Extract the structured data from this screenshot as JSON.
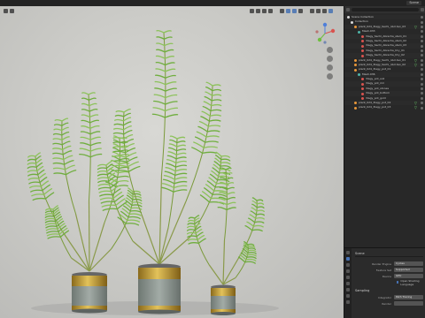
{
  "header": {
    "scene_label": "Scene"
  },
  "outliner": {
    "rows": [
      {
        "label": "Scene Collection",
        "indent": 0,
        "icon": "white",
        "filter": false
      },
      {
        "label": "Collection",
        "indent": 1,
        "icon": "white",
        "filter": false
      },
      {
        "label": "plant_024_3lagy_Sachi_nbcl.tex_03",
        "indent": 2,
        "icon": "orange",
        "filter": true
      },
      {
        "label": "Mesh.033",
        "indent": 3,
        "icon": "teal",
        "filter": false
      },
      {
        "label": "3lagy_Sachi_Abrecha_stem_01",
        "indent": 4,
        "icon": "red",
        "filter": false
      },
      {
        "label": "3lagy_Sachi_Abrecha_stem_02",
        "indent": 4,
        "icon": "red",
        "filter": false
      },
      {
        "label": "3lagy_Sachi_Abrecha_stem_03",
        "indent": 4,
        "icon": "red",
        "filter": false
      },
      {
        "label": "3lagy_Sachi_Abrecha_Dry_01",
        "indent": 4,
        "icon": "red",
        "filter": false
      },
      {
        "label": "3lagy_Sachi_Abrecha_Dry_02",
        "indent": 4,
        "icon": "red",
        "filter": false
      },
      {
        "label": "plant_024_3lagy_Sachi_nbcl.tex_01",
        "indent": 2,
        "icon": "orange",
        "filter": true
      },
      {
        "label": "plant_024_3lagy_Sachi_nbcl.tex_02",
        "indent": 2,
        "icon": "orange",
        "filter": true
      },
      {
        "label": "plant_024_3lagy_pot_01",
        "indent": 2,
        "icon": "orange",
        "filter": false
      },
      {
        "label": "Mesh.036",
        "indent": 3,
        "icon": "teal",
        "filter": false
      },
      {
        "label": "3lagy_pot_soil",
        "indent": 4,
        "icon": "red",
        "filter": false
      },
      {
        "label": "3lagy_pot_rim",
        "indent": 4,
        "icon": "red",
        "filter": false
      },
      {
        "label": "3lagy_pot_stones",
        "indent": 4,
        "icon": "red",
        "filter": false
      },
      {
        "label": "3lagy_pot_bottom",
        "indent": 4,
        "icon": "red",
        "filter": false
      },
      {
        "label": "3lagy_pot_gold",
        "indent": 4,
        "icon": "red",
        "filter": false
      },
      {
        "label": "plant_024_3lagy_pot_02",
        "indent": 2,
        "icon": "orange",
        "filter": true
      },
      {
        "label": "plant_024_3lagy_pot_03",
        "indent": 2,
        "icon": "orange",
        "filter": true
      }
    ]
  },
  "properties": {
    "title": "Scene",
    "rows": [
      {
        "key": "Render Engine",
        "value": "Cycles"
      },
      {
        "key": "Feature Set",
        "value": "Supported"
      },
      {
        "key": "Device",
        "value": "GPU"
      }
    ],
    "checkbox_label": "Open Shading Language",
    "section_title": "Sampling",
    "rows2": [
      {
        "key": "Integrator",
        "value": "Path Tracing"
      },
      {
        "key": "Render",
        "value": ""
      },
      {
        "key": "Viewport",
        "value": ""
      }
    ]
  },
  "colors": {
    "accent": "#4772b3",
    "pot_body": "#8c9691",
    "pot_gold": "#c9a23a",
    "leaf": "#6fae3e"
  }
}
